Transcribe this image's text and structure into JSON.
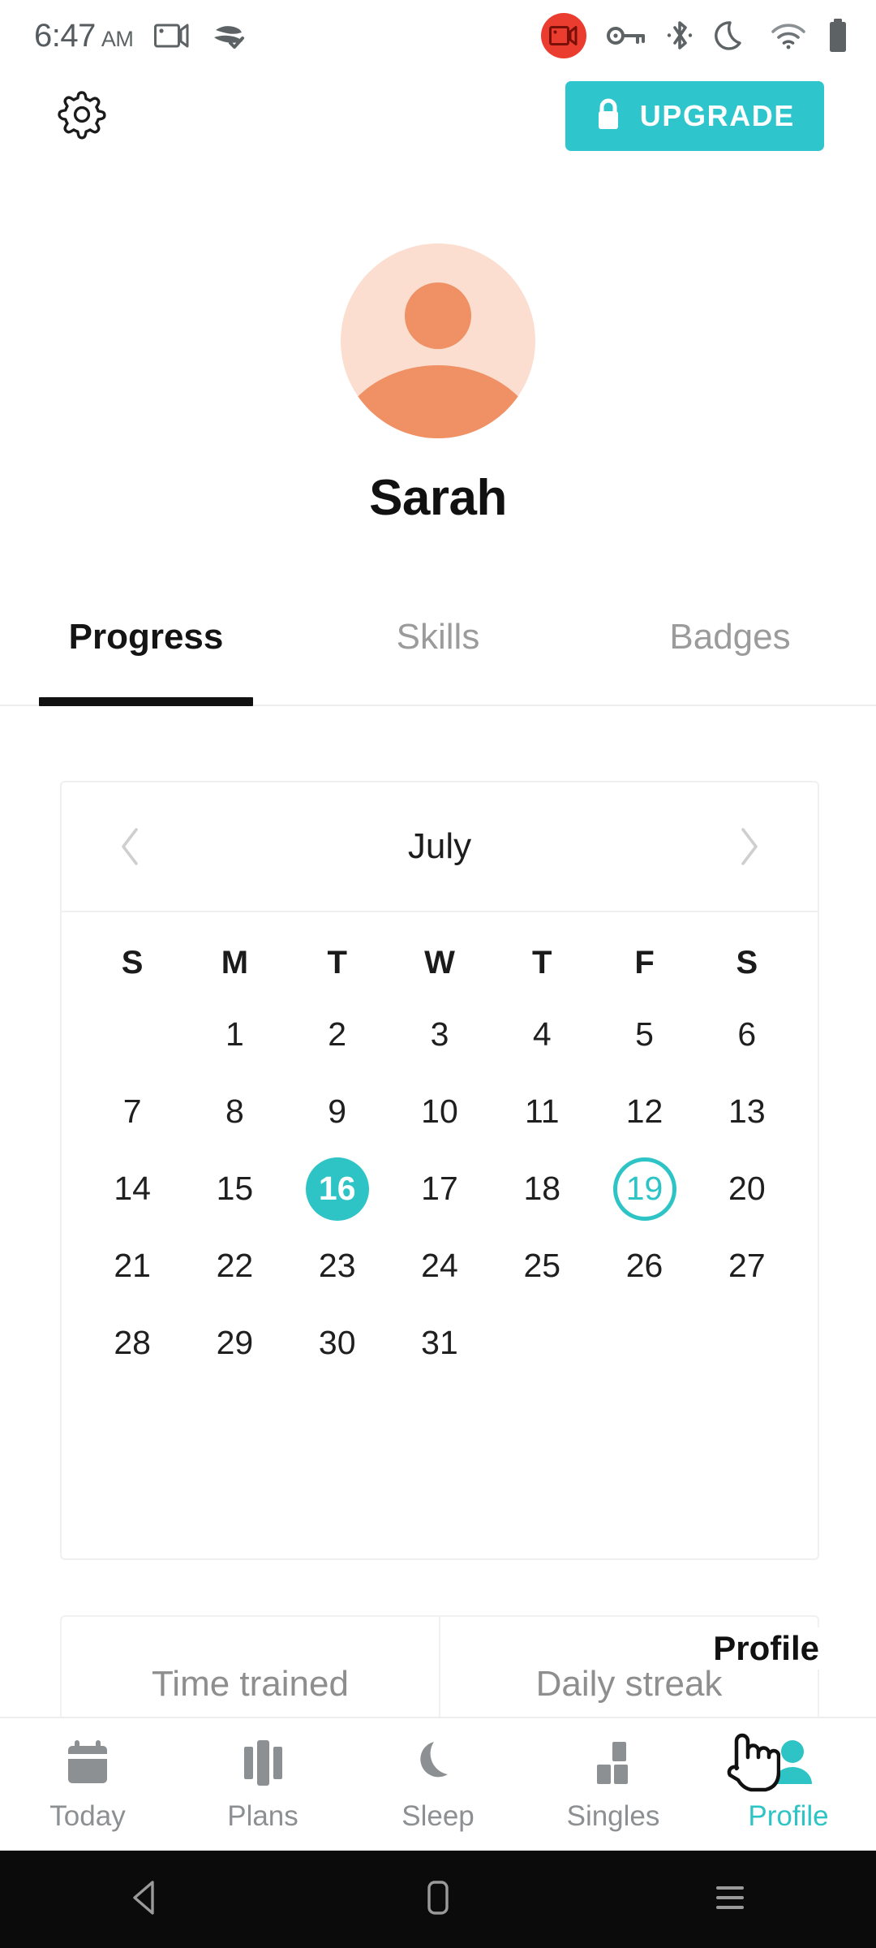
{
  "status_bar": {
    "time": "6:47",
    "ampm": "AM",
    "icons_left": [
      "screen-record-icon",
      "vpn-check-icon"
    ],
    "icons_right": [
      "recording-badge-icon",
      "vpn-key-icon",
      "bluetooth-icon",
      "do-not-disturb-moon-icon",
      "wifi-icon",
      "battery-icon"
    ]
  },
  "header": {
    "settings_icon": "gear-icon",
    "upgrade_label": "UPGRADE",
    "upgrade_icon": "lock-icon"
  },
  "profile": {
    "avatar_icon": "person-avatar-icon",
    "name": "Sarah"
  },
  "tabs": [
    {
      "label": "Progress",
      "active": true
    },
    {
      "label": "Skills",
      "active": false
    },
    {
      "label": "Badges",
      "active": false
    }
  ],
  "calendar": {
    "month": "July",
    "prev_icon": "chevron-left-icon",
    "next_icon": "chevron-right-icon",
    "weekdays": [
      "S",
      "M",
      "T",
      "W",
      "T",
      "F",
      "S"
    ],
    "leading_blanks": 1,
    "days": [
      1,
      2,
      3,
      4,
      5,
      6,
      7,
      8,
      9,
      10,
      11,
      12,
      13,
      14,
      15,
      16,
      17,
      18,
      19,
      20,
      21,
      22,
      23,
      24,
      25,
      26,
      27,
      28,
      29,
      30,
      31
    ],
    "selected_day": 16,
    "today_day": 19,
    "accent_color": "#2ec4c6"
  },
  "stats": {
    "items": [
      {
        "label": "Time trained"
      },
      {
        "label": "Daily streak"
      }
    ]
  },
  "overlay": {
    "profile_tooltip": "Profile",
    "cursor_icon": "pointer-hand-cursor-icon"
  },
  "bottom_nav": [
    {
      "label": "Today",
      "icon": "calendar-icon",
      "active": false
    },
    {
      "label": "Plans",
      "icon": "columns-icon",
      "active": false
    },
    {
      "label": "Sleep",
      "icon": "moon-icon",
      "active": false
    },
    {
      "label": "Singles",
      "icon": "blocks-icon",
      "active": false
    },
    {
      "label": "Profile",
      "icon": "person-icon",
      "active": true
    }
  ],
  "android_nav": {
    "back": "back-triangle-icon",
    "home": "home-square-icon",
    "recents": "recents-menu-icon"
  },
  "colors": {
    "accent_teal": "#2ec4c6",
    "avatar_bg": "#fbded0",
    "avatar_fg": "#ef9164",
    "record_red": "#ea3d2f"
  }
}
